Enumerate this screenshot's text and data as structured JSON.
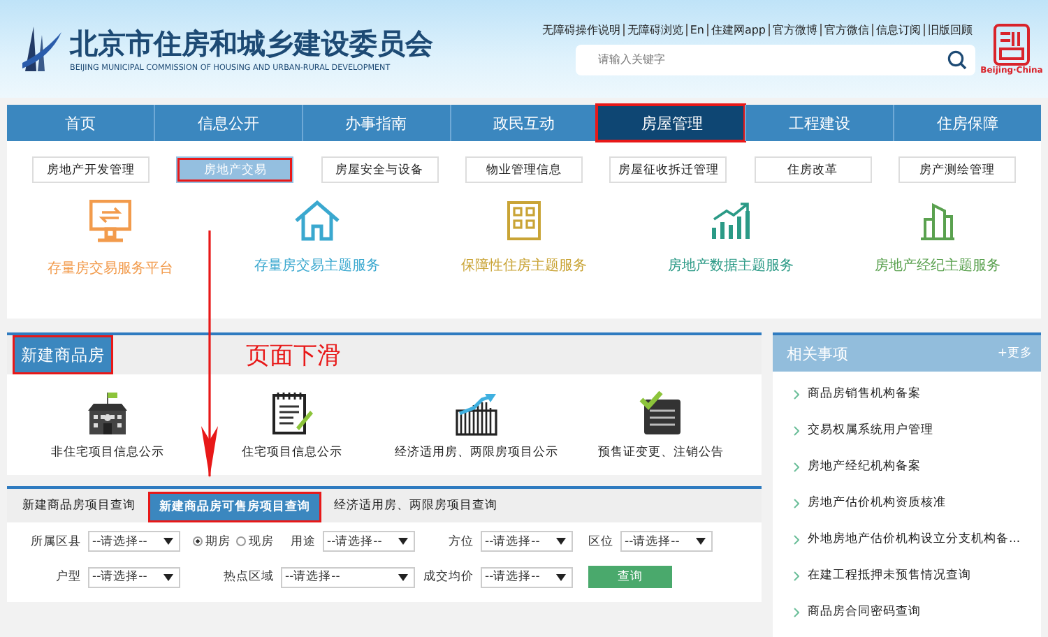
{
  "header": {
    "title": "北京市住房和城乡建设委员会",
    "subtitle": "BEIJING MUNICIPAL COMMISSION OF HOUSING AND URBAN-RURAL DEVELOPMENT",
    "links": [
      "无障碍操作说明",
      "无障碍浏览",
      "En",
      "住建网app",
      "官方微博",
      "官方微信",
      "信息订阅",
      "旧版回顾"
    ],
    "search_placeholder": "请输入关键字",
    "stamp_caption": "Beijing·China"
  },
  "nav": [
    {
      "label": "首页",
      "selected": false,
      "annotated": false
    },
    {
      "label": "信息公开",
      "selected": false,
      "annotated": false
    },
    {
      "label": "办事指南",
      "selected": false,
      "annotated": false
    },
    {
      "label": "政民互动",
      "selected": false,
      "annotated": false
    },
    {
      "label": "房屋管理",
      "selected": true,
      "annotated": true
    },
    {
      "label": "工程建设",
      "selected": false,
      "annotated": false
    },
    {
      "label": "住房保障",
      "selected": false,
      "annotated": false
    }
  ],
  "subnav": [
    {
      "label": "房地产开发管理",
      "selected": false,
      "annotated": false
    },
    {
      "label": "房地产交易",
      "selected": true,
      "annotated": true
    },
    {
      "label": "房屋安全与设备",
      "selected": false,
      "annotated": false
    },
    {
      "label": "物业管理信息",
      "selected": false,
      "annotated": false
    },
    {
      "label": "房屋征收拆迁管理",
      "selected": false,
      "annotated": false
    },
    {
      "label": "住房改革",
      "selected": false,
      "annotated": false
    },
    {
      "label": "房产测绘管理",
      "selected": false,
      "annotated": false
    }
  ],
  "services": [
    {
      "label": "存量房交易服务平台",
      "kind": "monitor",
      "color": "#f29b4c"
    },
    {
      "label": "存量房交易主题服务",
      "kind": "house",
      "color": "#3aa8cf"
    },
    {
      "label": "保障性住房主题服务",
      "kind": "building",
      "color": "#c9a436"
    },
    {
      "label": "房地产数据主题服务",
      "kind": "chart",
      "color": "#2b9a86"
    },
    {
      "label": "房地产经纪主题服务",
      "kind": "towers",
      "color": "#5aa14f"
    }
  ],
  "new_homes": {
    "title": "新建商品房",
    "annotated": true,
    "annotation": "页面下滑",
    "scroll_arrow": true,
    "items": [
      {
        "label": "非住宅项目信息公示",
        "kind": "office"
      },
      {
        "label": "住宅项目信息公示",
        "kind": "notepad"
      },
      {
        "label": "经济适用房、两限房项目公示",
        "kind": "growth"
      },
      {
        "label": "预售证变更、注销公告",
        "kind": "checklist"
      }
    ]
  },
  "query": {
    "tabs": [
      {
        "label": "新建商品房项目查询",
        "selected": false,
        "annotated": false
      },
      {
        "label": "新建商品房可售房项目查询",
        "selected": true,
        "annotated": true
      },
      {
        "label": "经济适用房、两限房项目查询",
        "selected": false,
        "annotated": false
      }
    ],
    "rows": [
      [
        {
          "kind": "select",
          "label": "所属区县",
          "value": "--请选择--"
        },
        {
          "kind": "radio",
          "options": [
            {
              "label": "期房",
              "selected": true
            },
            {
              "label": "现房",
              "selected": false
            }
          ]
        },
        {
          "kind": "select",
          "label": "用途",
          "value": "--请选择--"
        },
        {
          "kind": "select",
          "label": "方位",
          "value": "--请选择--"
        },
        {
          "kind": "select",
          "label": "区位",
          "value": "--请选择--"
        }
      ],
      [
        {
          "kind": "select",
          "label": "户型",
          "value": "--请选择--"
        },
        "",
        {
          "kind": "select",
          "label": "热点区域",
          "value": "--请选择--"
        },
        {
          "kind": "select",
          "label": "成交均价",
          "value": "--请选择--"
        },
        {
          "kind": "button",
          "label": "查询"
        }
      ]
    ]
  },
  "related": {
    "title": "相关事项",
    "more": "+更多",
    "items": [
      "商品房销售机构备案",
      "交易权属系统用户管理",
      "房地产经纪机构备案",
      "房地产估价机构资质核准",
      "外地房地产估价机构设立分支机构备...",
      "在建工程抵押未预售情况查询",
      "商品房合同密码查询"
    ]
  }
}
